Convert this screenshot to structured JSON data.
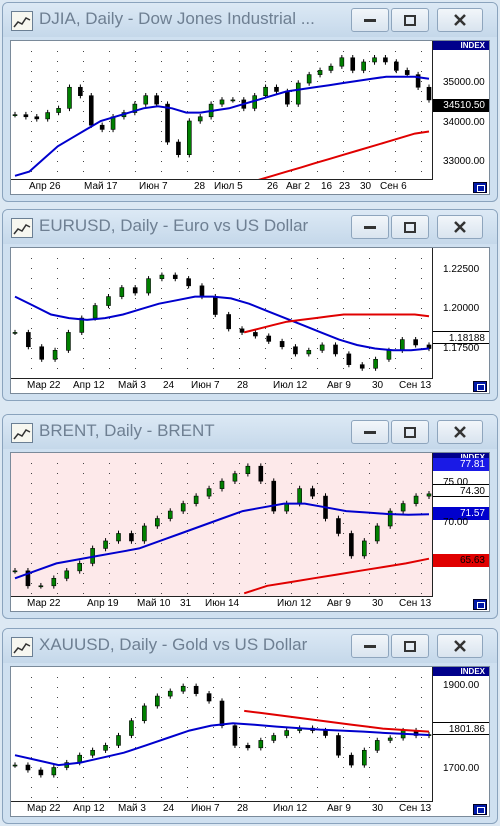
{
  "windows": [
    {
      "title": "DJIA, Daily - Dow Jones Industrial ...",
      "axis_title": "INDEX",
      "price_ticks": [
        "35000.00",
        "34000.00",
        "33000.00"
      ],
      "current_price": "34510.50",
      "date_ticks": [
        "Апр 26",
        "Май 17",
        "Июн 7",
        "28",
        "Июл 5",
        "26",
        "Авг 2",
        "16",
        "23",
        "30",
        "Сен 6"
      ],
      "chart_data": {
        "type": "line",
        "ylim": [
          32600,
          35850
        ],
        "series": [
          {
            "values": [
              34150,
              34100,
              34050,
              34200,
              34300,
              34800,
              34600,
              33900,
              33800,
              34100,
              34200,
              34400,
              34600,
              34400,
              33500,
              33200,
              34000,
              34100,
              34400,
              34500,
              34500,
              34300,
              34600,
              34800,
              34700,
              34400,
              34900,
              35100,
              35200,
              35300,
              35500,
              35200,
              35400,
              35500,
              35400,
              35200,
              35100,
              34800,
              34500
            ],
            "color": "#000000"
          },
          {
            "values": [
              32700,
              32800,
              33100,
              33400,
              33600,
              33800,
              34000,
              34100,
              34200,
              34300,
              34350,
              34300,
              34200,
              34200,
              34250,
              34300,
              34400,
              34500,
              34600,
              34700,
              34750,
              34800,
              34850,
              34900,
              34950,
              35000,
              35050,
              35050,
              35050,
              35000
            ],
            "color": "#0000cd"
          },
          {
            "values": [
              32500,
              32600,
              32700,
              32800,
              32900,
              33000,
              33100,
              33200,
              33300,
              33400,
              33500,
              33600,
              33700,
              33750
            ],
            "color": "#e00000"
          }
        ]
      }
    },
    {
      "title": "EURUSD, Daily - Euro vs US Dollar",
      "axis_title": "",
      "price_ticks": [
        "1.22500",
        "1.20000",
        "1.17500"
      ],
      "current_price": "1.18188",
      "date_ticks": [
        "Мар 22",
        "Апр 12",
        "Май 3",
        "24",
        "Июн 7",
        "28",
        "Июл 12",
        "Авг 9",
        "30",
        "Сен 13"
      ],
      "chart_data": {
        "type": "line",
        "ylim": [
          1.164,
          1.236
        ],
        "series": [
          {
            "values": [
              1.19,
              1.182,
              1.175,
              1.18,
              1.19,
              1.198,
              1.205,
              1.21,
              1.215,
              1.212,
              1.22,
              1.222,
              1.22,
              1.216,
              1.21,
              1.2,
              1.192,
              1.19,
              1.188,
              1.185,
              1.182,
              1.178,
              1.18,
              1.183,
              1.178,
              1.172,
              1.17,
              1.175,
              1.18,
              1.186,
              1.183,
              1.181
            ],
            "color": "#000000"
          },
          {
            "values": [
              1.21,
              1.205,
              1.2,
              1.198,
              1.197,
              1.198,
              1.2,
              1.203,
              1.206,
              1.208,
              1.21,
              1.21,
              1.209,
              1.206,
              1.202,
              1.198,
              1.194,
              1.19,
              1.186,
              1.183,
              1.181,
              1.18,
              1.18,
              1.181
            ],
            "color": "#0000cd"
          },
          {
            "values": [
              1.19,
              1.192,
              1.194,
              1.196,
              1.197,
              1.198,
              1.199,
              1.2,
              1.2,
              1.2,
              1.2,
              1.2,
              1.2,
              1.199
            ],
            "color": "#e00000"
          }
        ]
      }
    },
    {
      "title": "BRENT, Daily - BRENT",
      "axis_title": "INDEX",
      "price_ticks": [
        "75.00",
        "70.00"
      ],
      "price_labels": [
        "77.81",
        "74.30",
        "71.57",
        "65.63"
      ],
      "date_ticks": [
        "Мар 22",
        "Апр 19",
        "Май 10",
        "31",
        "Июн 14",
        "Июл 12",
        "Авг 9",
        "30",
        "Сен 13"
      ],
      "chart_data": {
        "type": "line",
        "ylim": [
          60.5,
          79.5
        ],
        "series": [
          {
            "values": [
              64,
              62,
              62,
              63,
              64,
              65,
              67,
              68,
              69,
              68,
              70,
              71,
              72,
              73,
              74,
              75,
              76,
              77,
              78,
              76,
              72,
              73,
              75,
              74,
              71,
              69,
              66,
              68,
              70,
              72,
              73,
              74,
              74.3
            ],
            "color": "#000000"
          },
          {
            "values": [
              63,
              64,
              65,
              65.5,
              66,
              66.5,
              67,
              68,
              69,
              70,
              71,
              72,
              72.5,
              73,
              73,
              72.5,
              72,
              71.8,
              71.6,
              71.5,
              71.57
            ],
            "color": "#0000cd"
          },
          {
            "values": [
              61,
              62,
              62.5,
              63,
              63.5,
              64,
              64.5,
              65,
              65.63
            ],
            "color": "#e00000"
          }
        ]
      }
    },
    {
      "title": "XAUUSD, Daily - Gold vs US Dollar",
      "axis_title": "INDEX",
      "price_ticks": [
        "1900.00",
        "1700.00"
      ],
      "current_price": "1801.86",
      "date_ticks": [
        "Мар 22",
        "Апр 12",
        "Май 3",
        "24",
        "Июн 7",
        "28",
        "Июл 12",
        "Авг 9",
        "30",
        "Сен 13"
      ],
      "chart_data": {
        "type": "line",
        "ylim": [
          1665,
          1935
        ],
        "series": [
          {
            "values": [
              1740,
              1730,
              1720,
              1735,
              1745,
              1760,
              1770,
              1780,
              1800,
              1830,
              1860,
              1880,
              1890,
              1900,
              1885,
              1870,
              1820,
              1780,
              1775,
              1790,
              1800,
              1810,
              1815,
              1810,
              1800,
              1760,
              1740,
              1770,
              1790,
              1795,
              1810,
              1800,
              1801.86
            ],
            "color": "#000000"
          },
          {
            "values": [
              1760,
              1750,
              1740,
              1745,
              1755,
              1765,
              1780,
              1795,
              1810,
              1820,
              1825,
              1822,
              1818,
              1815,
              1812,
              1810,
              1808,
              1805,
              1803,
              1801
            ],
            "color": "#0000cd"
          },
          {
            "values": [
              1850,
              1846,
              1842,
              1838,
              1834,
              1830,
              1826,
              1822,
              1818,
              1814,
              1812,
              1810,
              1808
            ],
            "color": "#e00000"
          }
        ]
      }
    }
  ]
}
